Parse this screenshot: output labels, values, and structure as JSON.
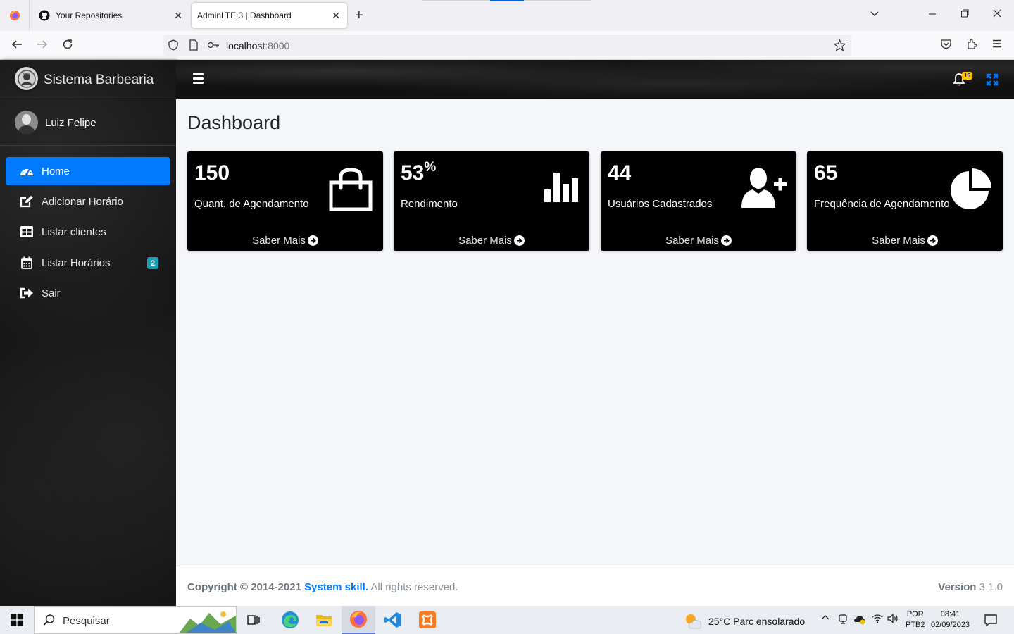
{
  "browser": {
    "tabs": [
      {
        "title": "Your Repositories",
        "close": "✕"
      },
      {
        "title": "AdminLTE 3 | Dashboard",
        "close": "✕"
      }
    ],
    "new_tab": "+",
    "url_host": "localhost",
    "url_port": ":8000"
  },
  "sidebar": {
    "brand": "Sistema Barbearia",
    "user": "Luiz Felipe",
    "items": [
      {
        "label": "Home",
        "icon": "tachometer-icon",
        "active": true
      },
      {
        "label": "Adicionar Horário",
        "icon": "edit-icon"
      },
      {
        "label": "Listar clientes",
        "icon": "table-icon"
      },
      {
        "label": "Listar Horários",
        "icon": "calendar-icon",
        "badge": "2"
      },
      {
        "label": "Sair",
        "icon": "sign-out-icon"
      }
    ]
  },
  "topnav": {
    "notification_count": "15",
    "colors": {
      "badge": "#ffc107",
      "expand": "#007bff"
    }
  },
  "main": {
    "title": "Dashboard",
    "cards": [
      {
        "value": "150",
        "suffix": "",
        "label": "Quant. de Agendamento",
        "link": "Saber Mais",
        "icon": "shopping-bag-icon"
      },
      {
        "value": "53",
        "suffix": "%",
        "label": "Rendimento",
        "link": "Saber Mais",
        "icon": "bar-chart-icon"
      },
      {
        "value": "44",
        "suffix": "",
        "label": "Usuários Cadastrados",
        "link": "Saber Mais",
        "icon": "user-plus-icon"
      },
      {
        "value": "65",
        "suffix": "",
        "label": "Frequência de Agendamento",
        "link": "Saber Mais",
        "icon": "pie-chart-icon"
      }
    ]
  },
  "footer": {
    "copyright": "Copyright © 2014-2021 ",
    "brand": "System skill.",
    "rights": " All rights reserved.",
    "version_label": "Version",
    "version": " 3.1.0"
  },
  "taskbar": {
    "search_placeholder": "Pesquisar",
    "weather": "25°C  Parc ensolarado",
    "lang_1": "POR",
    "lang_2": "PTB2",
    "time": "08:41",
    "date": "02/09/2023"
  },
  "colors": {
    "accent": "#007bff",
    "menu_badge": "#17a2b8",
    "card_bg": "#000000"
  }
}
